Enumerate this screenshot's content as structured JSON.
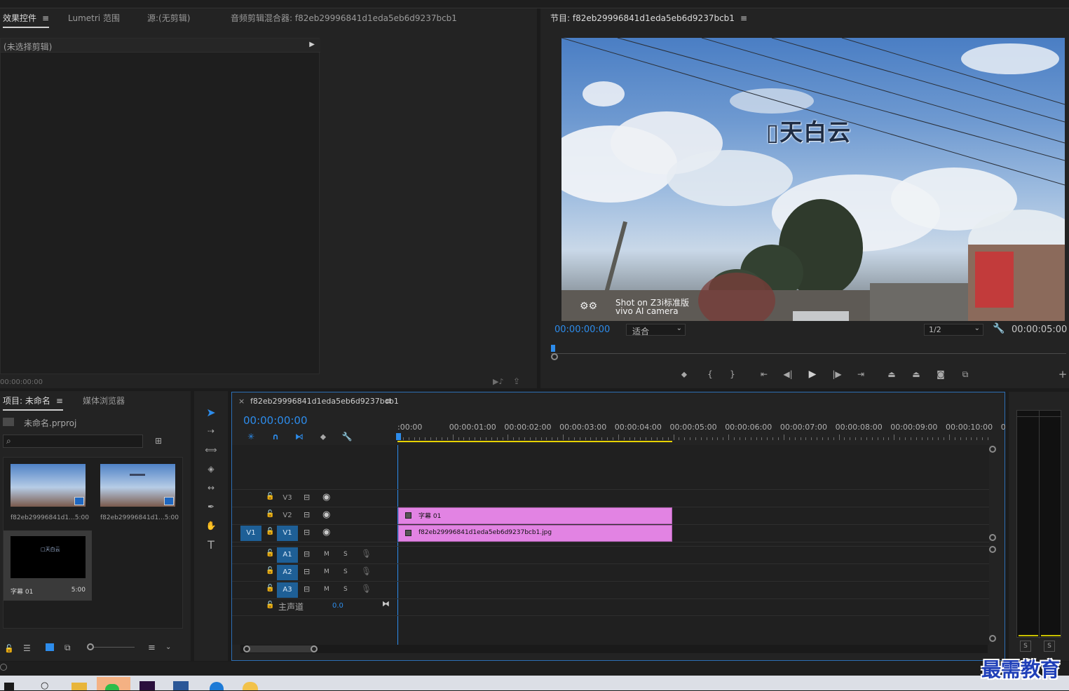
{
  "source_panel": {
    "tabs": [
      {
        "label": "效果控件",
        "active": true
      },
      {
        "label": "Lumetri 范围",
        "active": false
      },
      {
        "label": "源:(无剪辑)",
        "active": false
      },
      {
        "label": "音频剪辑混合器: f82eb29996841d1eda5eb6d9237bcb1",
        "active": false
      }
    ],
    "no_clip_label": "(未选择剪辑)",
    "timecode": "00:00:00:00"
  },
  "program_monitor": {
    "tab_label": "节目: f82eb29996841d1eda5eb6d9237bcb1",
    "overlay_title": "▯天白云",
    "watermark_line1": "Shot on Z3i标准版",
    "watermark_line2": "vivo AI camera",
    "current_time": "00:00:00:00",
    "fit_label": "适合",
    "resolution_label": "1/2",
    "duration": "00:00:05:00"
  },
  "project_panel": {
    "tabs": [
      {
        "label": "项目: 未命名",
        "active": true
      },
      {
        "label": "媒体浏览器",
        "active": false
      }
    ],
    "project_file": "未命名.prproj",
    "items": [
      {
        "name": "f82eb29996841d1...",
        "duration": "5:00",
        "kind": "sky"
      },
      {
        "name": "f82eb29996841d1...",
        "duration": "5:00",
        "kind": "sky-title"
      },
      {
        "name": "字幕 01",
        "duration": "5:00",
        "kind": "black",
        "preview_text": "□天白云"
      }
    ]
  },
  "timeline": {
    "tab_label": "f82eb29996841d1eda5eb6d9237bcb1",
    "close_glyph": "×",
    "current_time": "00:00:00:00",
    "ruler_labels": [
      ":00:00",
      "00:00:01:00",
      "00:00:02:00",
      "00:00:03:00",
      "00:00:04:00",
      "00:00:05:00",
      "00:00:06:00",
      "00:00:07:00",
      "00:00:08:00",
      "00:00:09:00",
      "00:00:10:00",
      "0"
    ],
    "video_tracks": [
      {
        "id": "V3",
        "target": ""
      },
      {
        "id": "V2",
        "target": ""
      },
      {
        "id": "V1",
        "target": "V1"
      }
    ],
    "audio_tracks": [
      {
        "id": "A1",
        "m": "M",
        "s": "S"
      },
      {
        "id": "A2",
        "m": "M",
        "s": "S"
      },
      {
        "id": "A3",
        "m": "M",
        "s": "S"
      }
    ],
    "master_label": "主声道",
    "master_value": "0.0",
    "clips": [
      {
        "track": "V2",
        "name": "字幕 01",
        "color": "#e283e3"
      },
      {
        "track": "V1",
        "name": "f82eb29996841d1eda5eb6d9237bcb1.jpg",
        "color": "#e283e3"
      }
    ]
  },
  "meter": {
    "s_left": "S",
    "s_right": "S"
  },
  "brand_watermark": "最需教育",
  "colors": {
    "accent_blue": "#2d8ceb",
    "clip_pink": "#e283e3",
    "work_area_yellow": "#e6d200",
    "track_target_blue": "#1e5f96"
  }
}
